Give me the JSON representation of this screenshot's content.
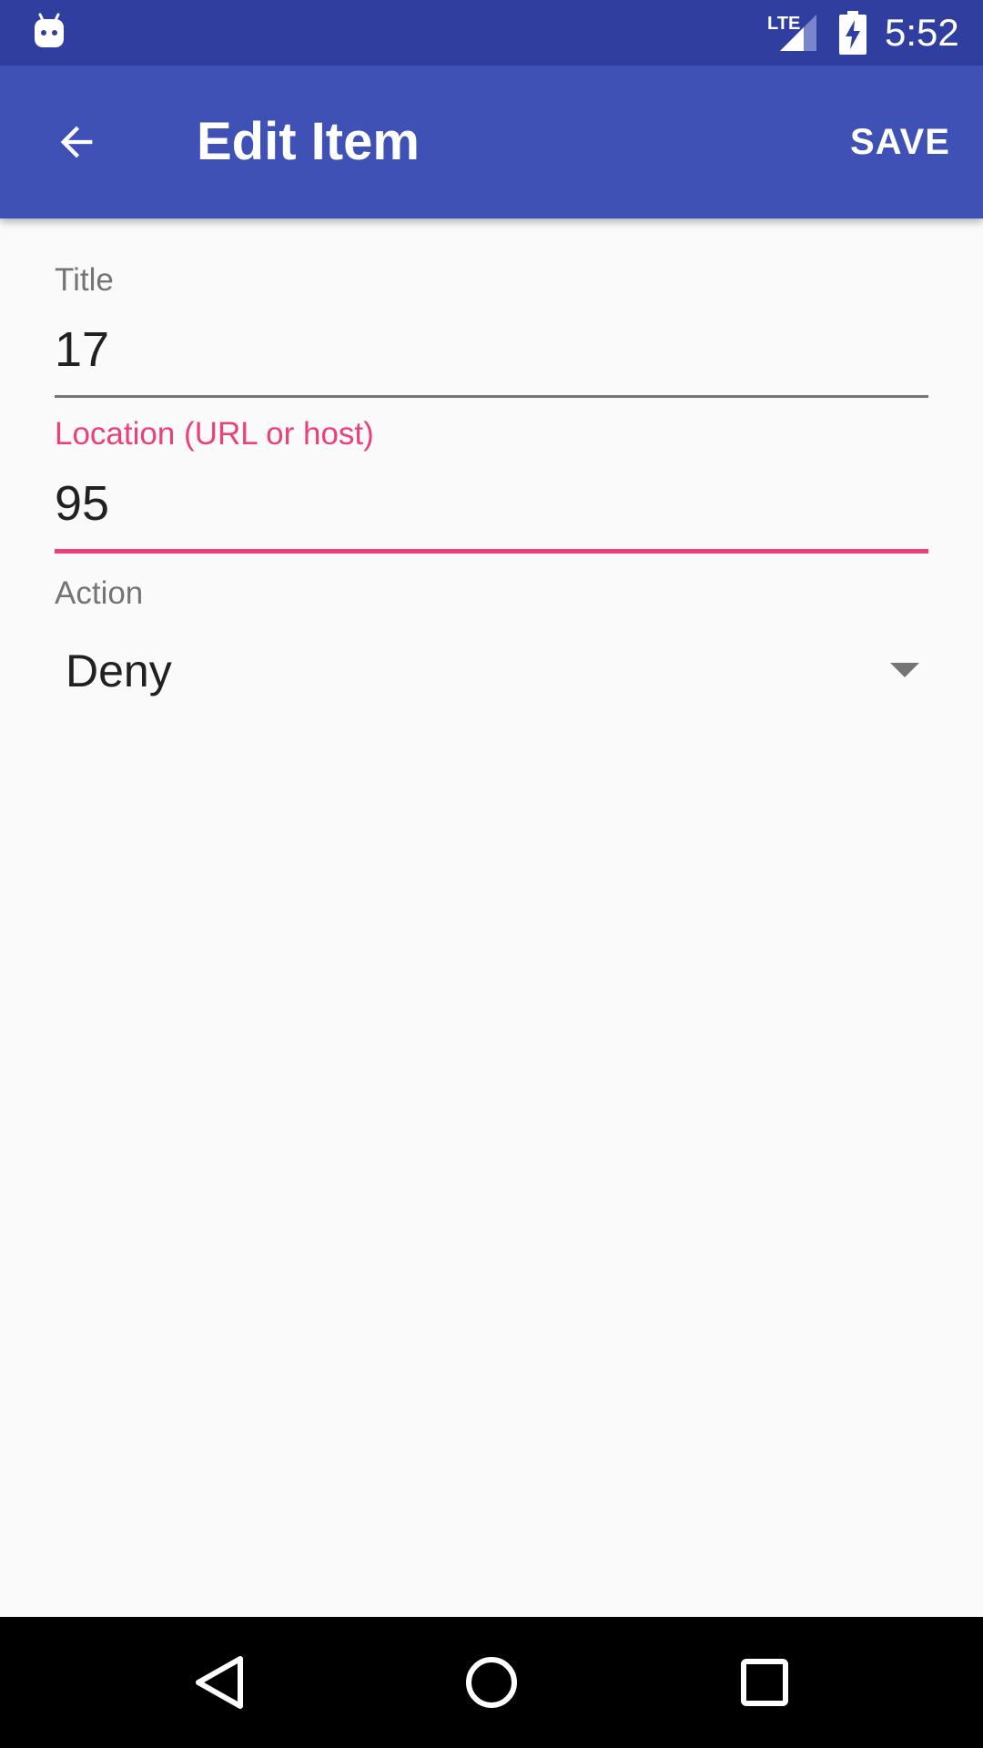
{
  "status_bar": {
    "time": "5:52",
    "network": "LTE",
    "icons": [
      "android-bot-icon",
      "lte-signal-icon",
      "battery-charging-icon"
    ]
  },
  "app_bar": {
    "title": "Edit Item",
    "save_label": "SAVE",
    "back_icon": "arrow-back-icon"
  },
  "form": {
    "title_field": {
      "label": "Title",
      "value": "17"
    },
    "location_field": {
      "label": "Location (URL or host)",
      "value": "95",
      "focused": true
    },
    "action_field": {
      "label": "Action",
      "selected": "Deny"
    }
  },
  "colors": {
    "primary": "#3F51B5",
    "primary_dark": "#303F9F",
    "accent": "#EC407A",
    "background": "#FAFAFA"
  },
  "nav_bar": {
    "icons": [
      "nav-back-icon",
      "nav-home-icon",
      "nav-recents-icon"
    ]
  }
}
